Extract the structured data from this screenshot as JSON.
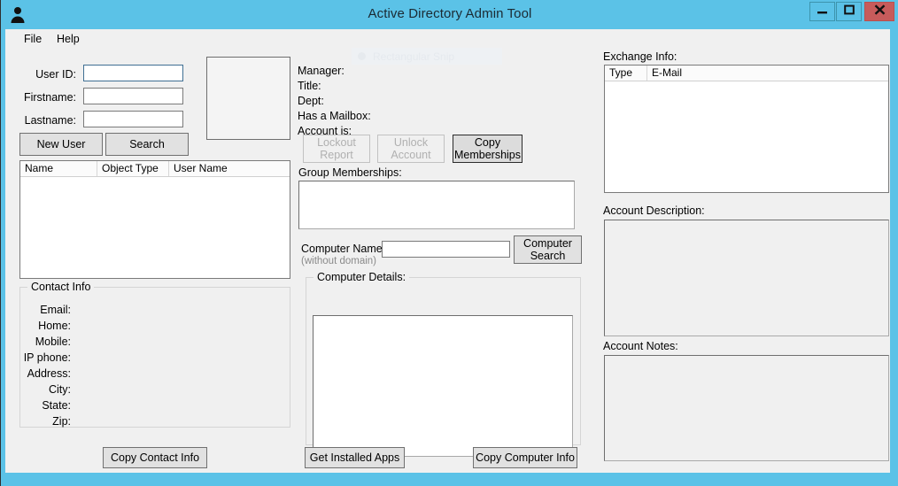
{
  "window": {
    "title": "Active Directory Admin Tool",
    "icon": "user-icon",
    "frame_color": "#5bc2e7",
    "close_color": "#c75b5b",
    "controls": {
      "minimize": "minimize-icon",
      "maximize": "maximize-icon",
      "close": "close-icon"
    }
  },
  "menu": {
    "items": [
      {
        "label": "File"
      },
      {
        "label": "Help"
      }
    ]
  },
  "overlay": {
    "snip_label": "Rectangular Snip",
    "snip_icon": "camera-icon"
  },
  "user_search": {
    "fields": [
      {
        "label": "User ID:",
        "value": "",
        "placeholder": ""
      },
      {
        "label": "Firstname:",
        "value": "",
        "placeholder": ""
      },
      {
        "label": "Lastname:",
        "value": "",
        "placeholder": ""
      }
    ],
    "buttons": [
      {
        "label": "New User"
      },
      {
        "label": "Search"
      }
    ],
    "photo_placeholder": "user-photo-placeholder"
  },
  "results_list": {
    "columns": [
      "Name",
      "Object Type",
      "User Name"
    ],
    "rows": []
  },
  "contact_info": {
    "title": "Contact Info",
    "fields": [
      {
        "label": "Email:",
        "value": ""
      },
      {
        "label": "Home:",
        "value": ""
      },
      {
        "label": "Mobile:",
        "value": ""
      },
      {
        "label": "IP phone:",
        "value": ""
      },
      {
        "label": "Address:",
        "value": ""
      },
      {
        "label": "City:",
        "value": ""
      },
      {
        "label": "State:",
        "value": ""
      },
      {
        "label": "Zip:",
        "value": ""
      }
    ],
    "copy_button": "Copy Contact Info"
  },
  "account_details": {
    "fields": [
      {
        "label": "Manager:",
        "value": ""
      },
      {
        "label": "Title:",
        "value": ""
      },
      {
        "label": "Dept:",
        "value": ""
      },
      {
        "label": "Has a Mailbox:",
        "value": ""
      },
      {
        "label": "Account is:",
        "value": ""
      }
    ],
    "buttons": [
      {
        "label": "Lockout\nReport",
        "enabled": false
      },
      {
        "label": "Unlock\nAccount",
        "enabled": false
      },
      {
        "label": "Copy\nMemberships",
        "enabled": true
      }
    ],
    "group_memberships_label": "Group Memberships:",
    "group_memberships_value": ""
  },
  "computer": {
    "name_label": "Computer Name:",
    "name_sublabel": "(without domain)",
    "name_value": "",
    "search_button": "Computer\nSearch",
    "details_title": "Computer Details:",
    "details_value": "",
    "get_apps_button": "Get Installed Apps",
    "copy_button": "Copy Computer Info"
  },
  "exchange": {
    "title": "Exchange Info:",
    "columns": [
      "Type",
      "E-Mail"
    ],
    "rows": []
  },
  "account_description": {
    "title": "Account Description:",
    "value": ""
  },
  "account_notes": {
    "title": "Account Notes:",
    "value": ""
  }
}
